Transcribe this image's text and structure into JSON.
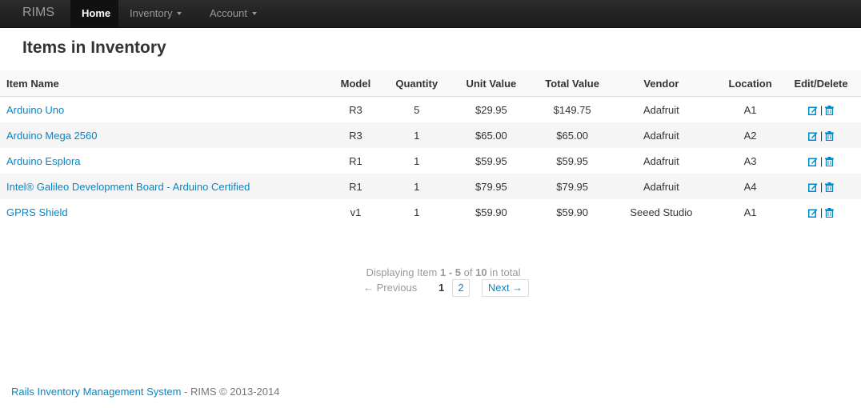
{
  "navbar": {
    "brand": "RIMS",
    "home": "Home",
    "inventory": "Inventory",
    "account": "Account"
  },
  "page_title": "Items in Inventory",
  "table": {
    "headers": [
      "Item Name",
      "Model",
      "Quantity",
      "Unit Value",
      "Total Value",
      "Vendor",
      "Location",
      "Edit/Delete"
    ],
    "rows": [
      {
        "name": "Arduino Uno",
        "model": "R3",
        "qty": "5",
        "unit": "$29.95",
        "total": "$149.75",
        "vendor": "Adafruit",
        "location": "A1"
      },
      {
        "name": "Arduino Mega 2560",
        "model": "R3",
        "qty": "1",
        "unit": "$65.00",
        "total": "$65.00",
        "vendor": "Adafruit",
        "location": "A2"
      },
      {
        "name": "Arduino Esplora",
        "model": "R1",
        "qty": "1",
        "unit": "$59.95",
        "total": "$59.95",
        "vendor": "Adafruit",
        "location": "A3"
      },
      {
        "name": "Intel® Galileo Development Board - Arduino Certified",
        "model": "R1",
        "qty": "1",
        "unit": "$79.95",
        "total": "$79.95",
        "vendor": "Adafruit",
        "location": "A4"
      },
      {
        "name": "GPRS Shield",
        "model": "v1",
        "qty": "1",
        "unit": "$59.90",
        "total": "$59.90",
        "vendor": "Seeed Studio",
        "location": "A1"
      }
    ],
    "action_separator": "|"
  },
  "pagination": {
    "info_prefix": "Displaying Item ",
    "range": "1 - 5",
    "of": " of ",
    "total": "10",
    "suffix": " in total",
    "previous": "← Previous",
    "current": "1",
    "page2": "2",
    "next": "Next →"
  },
  "footer": {
    "link": "Rails Inventory Management System",
    "rest": " - RIMS © 2013-2014"
  },
  "colors": {
    "link": "#0088cc",
    "navbar": "#1b1b1b"
  },
  "icons": {
    "edit": "edit-icon",
    "delete": "trash-icon"
  }
}
